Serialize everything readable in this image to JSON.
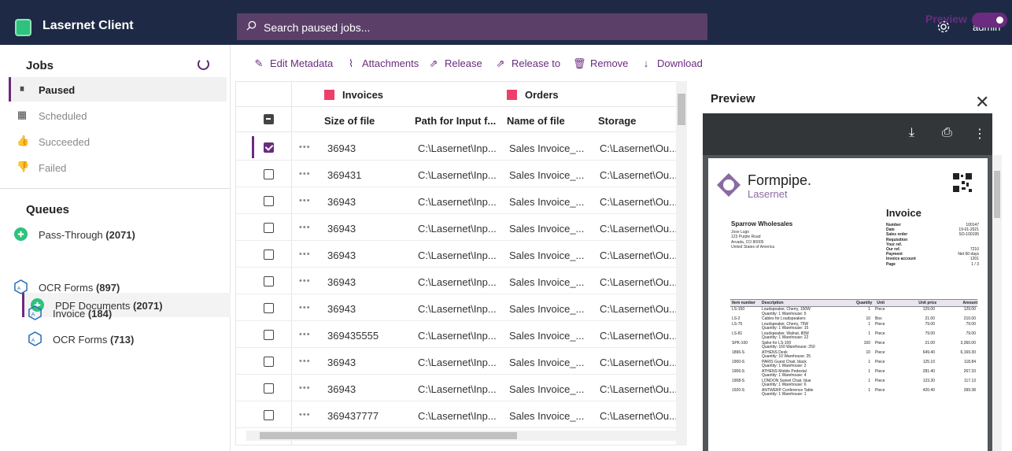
{
  "app": {
    "title": "Lasernet Client",
    "user": "admin"
  },
  "search": {
    "placeholder": "Search paused jobs..."
  },
  "sidebar": {
    "jobs_heading": "Jobs",
    "jobs": [
      {
        "label": "Paused",
        "icon": "pause-circle-icon",
        "active": true
      },
      {
        "label": "Scheduled",
        "icon": "calendar-icon"
      },
      {
        "label": "Succeeded",
        "icon": "thumbs-up-icon"
      },
      {
        "label": "Failed",
        "icon": "thumbs-down-icon"
      }
    ],
    "queues_heading": "Queues",
    "queues": [
      {
        "name": "Pass-Through",
        "count": "(2071)",
        "icon": "pass-through-icon"
      },
      {
        "name": "PDF Documents",
        "count": "(2071)",
        "icon": "pass-through-icon",
        "active": true
      },
      {
        "name": "OCR Forms",
        "count": "(897)",
        "icon": "ocr-icon"
      },
      {
        "name": "Invoice",
        "count": "(184)",
        "icon": "ocr-icon"
      },
      {
        "name": "OCR Forms",
        "count": "(713)",
        "icon": "ocr-icon"
      }
    ]
  },
  "toolbar": {
    "edit_metadata": "Edit Metadata",
    "attachments": "Attachments",
    "release": "Release",
    "release_to": "Release to",
    "remove": "Remove",
    "download": "Download",
    "preview_label": "Preview"
  },
  "grid": {
    "groups": [
      "Invoices",
      "Orders"
    ],
    "columns": [
      "Size of file",
      "Path for Input f...",
      "Name of file",
      "Storage"
    ],
    "rows": [
      {
        "size": "36943",
        "path": "C:\\Lasernet\\Inp...",
        "name": "Sales Invoice_...",
        "storage": "C:\\Lasernet\\Ou...",
        "checked": true
      },
      {
        "size": "369431",
        "path": "C:\\Lasernet\\Inp...",
        "name": "Sales Invoice_...",
        "storage": "C:\\Lasernet\\Ou..."
      },
      {
        "size": "36943",
        "path": "C:\\Lasernet\\Inp...",
        "name": "Sales Invoice_...",
        "storage": "C:\\Lasernet\\Ou..."
      },
      {
        "size": "36943",
        "path": "C:\\Lasernet\\Inp...",
        "name": "Sales Invoice_...",
        "storage": "C:\\Lasernet\\Ou..."
      },
      {
        "size": "36943",
        "path": "C:\\Lasernet\\Inp...",
        "name": "Sales Invoice_...",
        "storage": "C:\\Lasernet\\Ou..."
      },
      {
        "size": "36943",
        "path": "C:\\Lasernet\\Inp...",
        "name": "Sales Invoice_...",
        "storage": "C:\\Lasernet\\Ou..."
      },
      {
        "size": "36943",
        "path": "C:\\Lasernet\\Inp...",
        "name": "Sales Invoice_...",
        "storage": "C:\\Lasernet\\Ou..."
      },
      {
        "size": "369435555",
        "path": "C:\\Lasernet\\Inp...",
        "name": "Sales Invoice_...",
        "storage": "C:\\Lasernet\\Ou..."
      },
      {
        "size": "36943",
        "path": "C:\\Lasernet\\Inp...",
        "name": "Sales Invoice_...",
        "storage": "C:\\Lasernet\\Ou..."
      },
      {
        "size": "36943",
        "path": "C:\\Lasernet\\Inp...",
        "name": "Sales Invoice_...",
        "storage": "C:\\Lasernet\\Ou..."
      },
      {
        "size": "369437777",
        "path": "C:\\Lasernet\\Inp...",
        "name": "Sales Invoice_...",
        "storage": "C:\\Lasernet\\Ou..."
      }
    ]
  },
  "preview": {
    "title": "Preview",
    "doc": {
      "brand": "Formpipe.",
      "brand_sub": "Lasernet",
      "doc_title": "Invoice",
      "company": "Sparrow Wholesales",
      "address": [
        "Jose Lugo",
        "123 Purple Road",
        "Arvada, CO 80005",
        "United States of America"
      ],
      "meta": [
        [
          "Number",
          "100147"
        ],
        [
          "Date",
          "19-01-2021"
        ],
        [
          "Sales order",
          "SO-100195"
        ],
        [
          "Requisition",
          ""
        ],
        [
          "Your ref.",
          ""
        ],
        [
          "Our ref.",
          "7210"
        ],
        [
          "Payment",
          "Net 60 days"
        ],
        [
          "Invoice account",
          "1201"
        ],
        [
          "Page",
          "1 / 3"
        ]
      ],
      "table_headers": [
        "Item number",
        "Description",
        "Quantity",
        "Unit",
        "Unit price",
        "Amount"
      ],
      "lines": [
        [
          "LS-150",
          "Loudspeaker, Cherry, 150W",
          "Quantity: 1 Warehouse: 5",
          "1",
          "Piece",
          "129.00",
          "129.00"
        ],
        [
          "LS-2",
          "Cables for Loudspeakers",
          "",
          "10",
          "Box",
          "21.00",
          "210.00"
        ],
        [
          "LS-75",
          "Loudspeaker, Cherry, 75W",
          "Quantity: 1 Warehouse: 15",
          "1",
          "Piece",
          "79.00",
          "79.00"
        ],
        [
          "LS-81",
          "Loudspeaker, Walnut, 80W",
          "Quantity: 1 Warehouse: 22",
          "1",
          "Piece",
          "79.00",
          "79.00"
        ],
        [
          "SPK-100",
          "Spike for LS-100",
          "Quantity: 160 Warehouse: 250",
          "160",
          "Piece",
          "21.00",
          "3,360.00"
        ],
        [
          "1896-S",
          "ATHENS Desk",
          "Quantity: 10 Warehouse: 25",
          "10",
          "Piece",
          "649.40",
          "6,169.30"
        ],
        [
          "1900-S",
          "PARIS Guest Chair, black",
          "Quantity: 1 Warehouse: 2",
          "1",
          "Piece",
          "125.10",
          "118.84"
        ],
        [
          "1906-S",
          "ATHENS Mobile Pedestal",
          "Quantity: 1 Warehouse: 4",
          "1",
          "Piece",
          "281.40",
          "267.33"
        ],
        [
          "1908-S",
          "LONDON Swivel Chair, blue",
          "Quantity: 1 Warehouse: 6",
          "1",
          "Piece",
          "123.30",
          "117.13"
        ],
        [
          "1920-S",
          "ANTWERP Conference Table",
          "Quantity: 1 Warehouse: 1",
          "1",
          "Piece",
          "420.40",
          "399.38"
        ]
      ]
    }
  },
  "colors": {
    "topbar": "#1e2a45",
    "accent": "#6b2b7e",
    "search_bg": "#5b3f68",
    "group_marker": "#ee3f6b",
    "queue_icon": "#2ec27e"
  }
}
